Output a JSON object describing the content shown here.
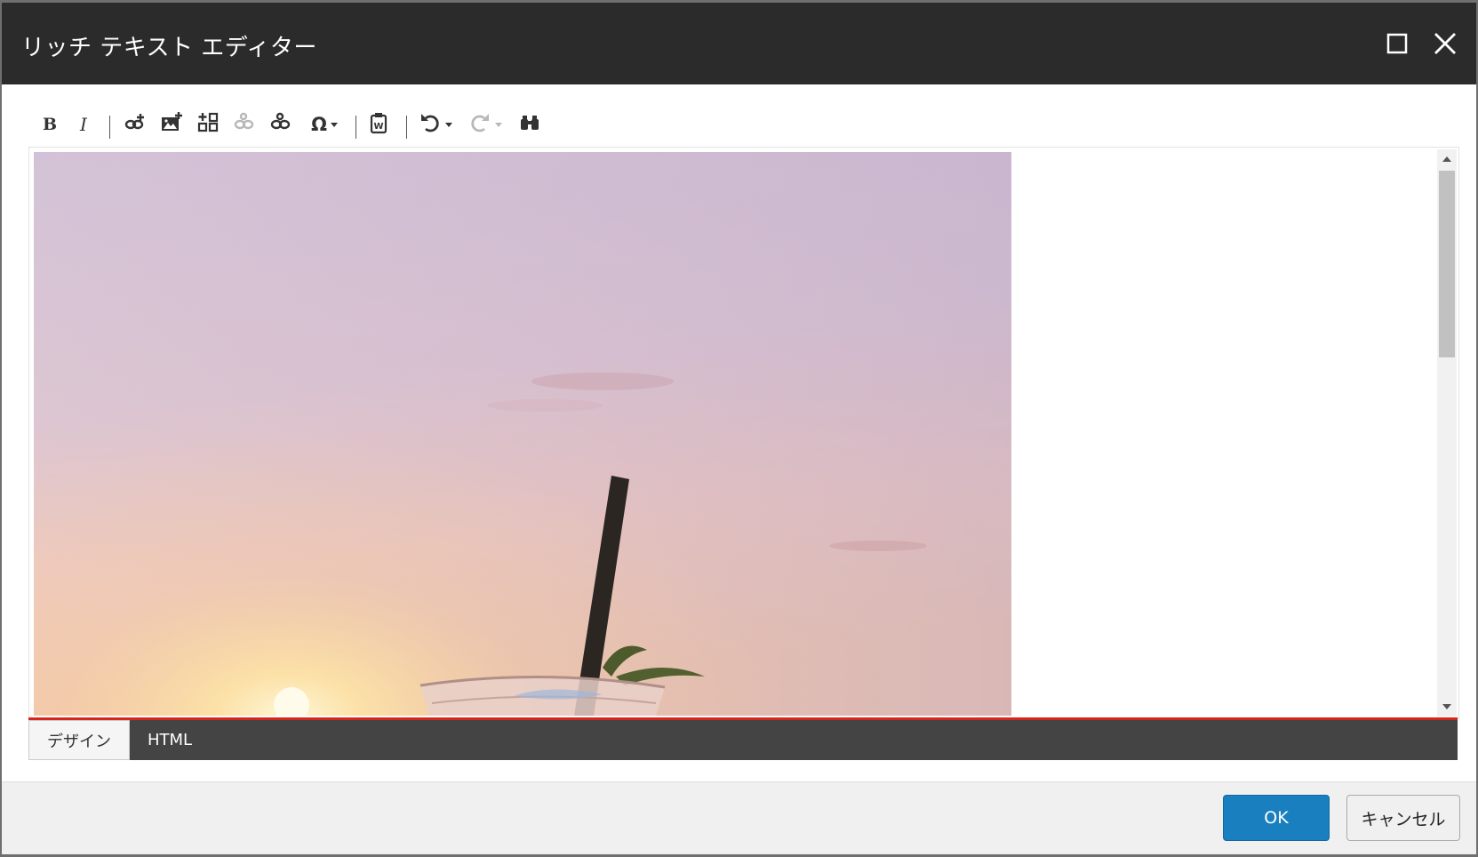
{
  "window": {
    "title": "リッチ テキスト エディター",
    "maximize_icon": "maximize-icon",
    "close_icon": "close-icon"
  },
  "toolbar": {
    "items": [
      {
        "name": "bold",
        "label": "B"
      },
      {
        "name": "italic",
        "label": "I"
      },
      {
        "name": "insert-link",
        "icon": "link-plus-icon"
      },
      {
        "name": "insert-image",
        "icon": "image-plus-icon"
      },
      {
        "name": "insert-embed",
        "icon": "embed-plus-icon"
      },
      {
        "name": "unlink",
        "icon": "unlink-icon",
        "disabled": true
      },
      {
        "name": "link-manage",
        "icon": "link-manage-icon"
      },
      {
        "name": "special-char",
        "label": "Ω"
      },
      {
        "name": "paste-word",
        "icon": "paste-word-icon"
      },
      {
        "name": "undo",
        "icon": "undo-icon"
      },
      {
        "name": "redo",
        "icon": "redo-icon",
        "disabled": true
      },
      {
        "name": "find",
        "icon": "binoculars-icon"
      }
    ]
  },
  "content": {
    "image_subject": "sunset-drink-photo"
  },
  "mode_tabs": {
    "design": "デザイン",
    "html": "HTML",
    "active": "design"
  },
  "footer": {
    "ok_label": "OK",
    "cancel_label": "キャンセル"
  },
  "colors": {
    "titlebar": "#2b2b2b",
    "accent_red": "#d9261c",
    "ok_button": "#1a7fbf"
  }
}
